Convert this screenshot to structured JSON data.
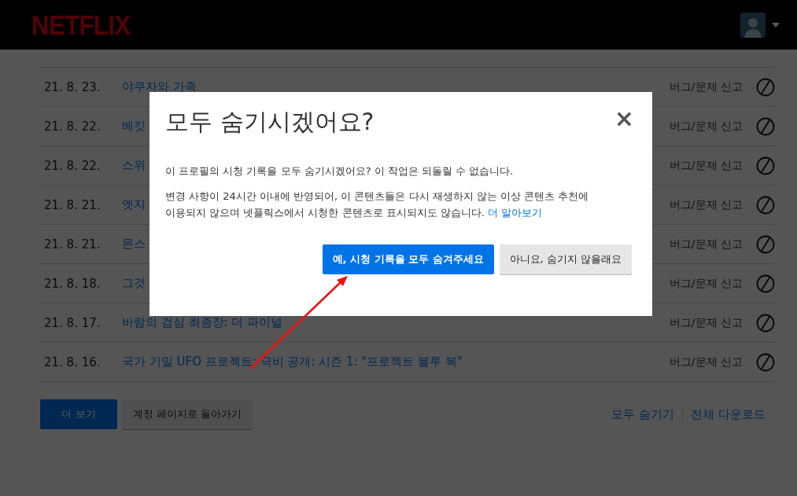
{
  "header": {
    "logo": "NETFLIX"
  },
  "history": [
    {
      "date": "21. 8. 23.",
      "title": "야쿠자와 가족",
      "report": "버그/문제 신고"
    },
    {
      "date": "21. 8. 22.",
      "title": "베킷",
      "report": "버그/문제 신고"
    },
    {
      "date": "21. 8. 22.",
      "title": "스위",
      "report": "버그/문제 신고"
    },
    {
      "date": "21. 8. 21.",
      "title": "엣지",
      "report": "버그/문제 신고"
    },
    {
      "date": "21. 8. 21.",
      "title": "몬스",
      "report": "버그/문제 신고"
    },
    {
      "date": "21. 8. 18.",
      "title": "그것",
      "report": "버그/문제 신고"
    },
    {
      "date": "21. 8. 17.",
      "title": "바람의 검심 최종장: 더 파이널",
      "report": "버그/문제 신고"
    },
    {
      "date": "21. 8. 16.",
      "title": "국가 기밀 UFO 프로젝트: 극비 공개: 시즌 1: \"프로젝트 블루 북\"",
      "report": "버그/문제 신고"
    }
  ],
  "footer": {
    "buttons": [
      {
        "label": "더 보기",
        "kind": "primary"
      },
      {
        "label": "계정 페이지로 돌아가기",
        "kind": "secondary"
      }
    ],
    "links": [
      "모두 숨기기",
      "전체 다운로드"
    ]
  },
  "dialog": {
    "title": "모두 숨기시겠어요?",
    "close": "×",
    "paragraphs": [
      "이 프로필의 시청 기록을 모두 숨기시겠어요? 이 작업은 되돌릴 수 없습니다.",
      "변경 사항이 24시간 이내에 반영되어, 이 콘텐츠들은 다시 재생하지 않는 이상 콘텐츠 추천에 이용되지 않으며 넷플릭스에서 시청한 콘텐츠로 표시되지도 않습니다."
    ],
    "link": "더 알아보기",
    "buttons": [
      {
        "label": "예, 시청 기록을 모두 숨겨주세요",
        "kind": "primary"
      },
      {
        "label": "아니요, 숨기지 않을래요",
        "kind": "secondary"
      }
    ]
  }
}
